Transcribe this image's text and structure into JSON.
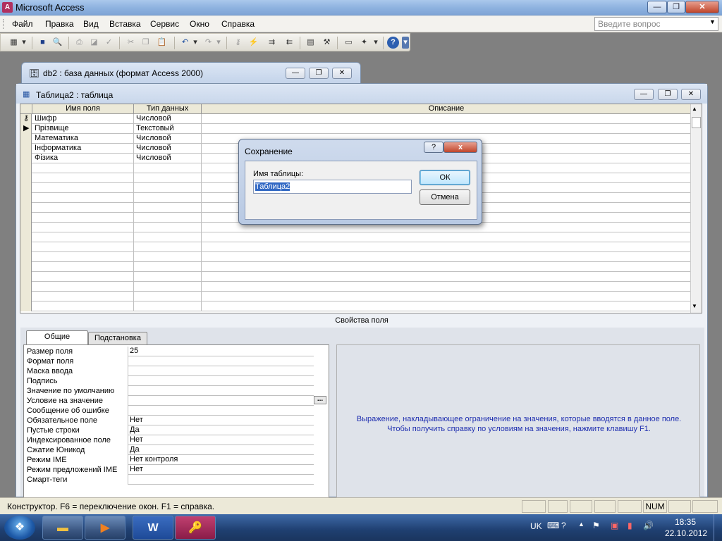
{
  "app": {
    "title": "Microsoft Access"
  },
  "menu": {
    "items": [
      "Файл",
      "Правка",
      "Вид",
      "Вставка",
      "Сервис",
      "Окно",
      "Справка"
    ],
    "ask_placeholder": "Введите вопрос"
  },
  "db_window": {
    "title": "db2 : база данных (формат Access 2000)"
  },
  "table_window": {
    "title": "Таблица2 : таблица"
  },
  "grid": {
    "headers": [
      "Имя поля",
      "Тип данных",
      "Описание"
    ],
    "rows": [
      {
        "name": "Шифр",
        "type": "Числовой",
        "marker": "key-icon"
      },
      {
        "name": "Прізвище",
        "type": "Текстовый",
        "marker": "current-row-arrow-icon"
      },
      {
        "name": "Математика",
        "type": "Числовой",
        "marker": ""
      },
      {
        "name": "Інформатика",
        "type": "Числовой",
        "marker": ""
      },
      {
        "name": "Фізика",
        "type": "Числовой",
        "marker": ""
      }
    ]
  },
  "properties": {
    "title": "Свойства поля",
    "tabs": [
      "Общие",
      "Подстановка"
    ],
    "active_tab": "Общие",
    "rows": [
      {
        "label": "Размер поля",
        "value": "25"
      },
      {
        "label": "Формат поля",
        "value": ""
      },
      {
        "label": "Маска ввода",
        "value": ""
      },
      {
        "label": "Подпись",
        "value": ""
      },
      {
        "label": "Значение по умолчанию",
        "value": ""
      },
      {
        "label": "Условие на значение",
        "value": ""
      },
      {
        "label": "Сообщение об ошибке",
        "value": ""
      },
      {
        "label": "Обязательное поле",
        "value": "Нет"
      },
      {
        "label": "Пустые строки",
        "value": "Да"
      },
      {
        "label": "Индексированное поле",
        "value": "Нет"
      },
      {
        "label": "Сжатие Юникод",
        "value": "Да"
      },
      {
        "label": "Режим IME",
        "value": "Нет контроля"
      },
      {
        "label": "Режим предложений IME",
        "value": "Нет"
      },
      {
        "label": "Смарт-теги",
        "value": ""
      }
    ],
    "builder_label": "...",
    "help_line1": "Выражение, накладывающее ограничение на значения, которые вводятся в данное поле.",
    "help_line2": "Чтобы получить справку по условиям на значения, нажмите клавишу F1."
  },
  "dialog": {
    "title": "Сохранение",
    "help_label": "?",
    "close_label": "x",
    "field_label": "Имя таблицы:",
    "field_value": "Таблица2",
    "ok_label": "ОК",
    "cancel_label": "Отмена"
  },
  "status": {
    "text": "Конструктор.  F6 = переключение окон.  F1 = справка.",
    "num": "NUM"
  },
  "taskbar": {
    "lang": "UK",
    "time": "18:35",
    "date": "22.10.2012"
  }
}
